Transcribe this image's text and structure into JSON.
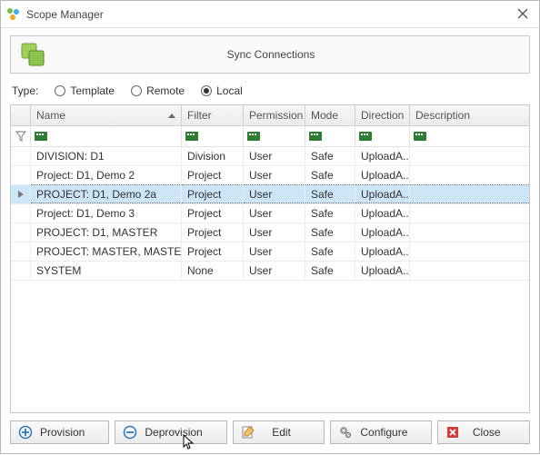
{
  "window": {
    "title": "Scope Manager"
  },
  "banner": {
    "title": "Sync Connections"
  },
  "type": {
    "label": "Type:",
    "options": [
      "Template",
      "Remote",
      "Local"
    ],
    "selected": "Local"
  },
  "columns": {
    "name": "Name",
    "filter": "Filter",
    "permission": "Permission",
    "mode": "Mode",
    "direction": "Direction",
    "description": "Description"
  },
  "rows": [
    {
      "name": "DIVISION: D1",
      "filter": "Division",
      "permission": "User",
      "mode": "Safe",
      "direction": "UploadA...",
      "description": "",
      "selected": false
    },
    {
      "name": "Project: D1, Demo 2",
      "filter": "Project",
      "permission": "User",
      "mode": "Safe",
      "direction": "UploadA...",
      "description": "",
      "selected": false
    },
    {
      "name": "PROJECT: D1, Demo 2a",
      "filter": "Project",
      "permission": "User",
      "mode": "Safe",
      "direction": "UploadA...",
      "description": "",
      "selected": true
    },
    {
      "name": "Project: D1, Demo 3",
      "filter": "Project",
      "permission": "User",
      "mode": "Safe",
      "direction": "UploadA...",
      "description": "",
      "selected": false
    },
    {
      "name": "PROJECT: D1, MASTER",
      "filter": "Project",
      "permission": "User",
      "mode": "Safe",
      "direction": "UploadA...",
      "description": "",
      "selected": false
    },
    {
      "name": "PROJECT: MASTER, MASTER",
      "filter": "Project",
      "permission": "User",
      "mode": "Safe",
      "direction": "UploadA...",
      "description": "",
      "selected": false
    },
    {
      "name": "SYSTEM",
      "filter": "None",
      "permission": "User",
      "mode": "Safe",
      "direction": "UploadA...",
      "description": "",
      "selected": false
    }
  ],
  "buttons": {
    "provision": "Provision",
    "deprovision": "Deprovision",
    "edit": "Edit",
    "configure": "Configure",
    "close": "Close"
  }
}
